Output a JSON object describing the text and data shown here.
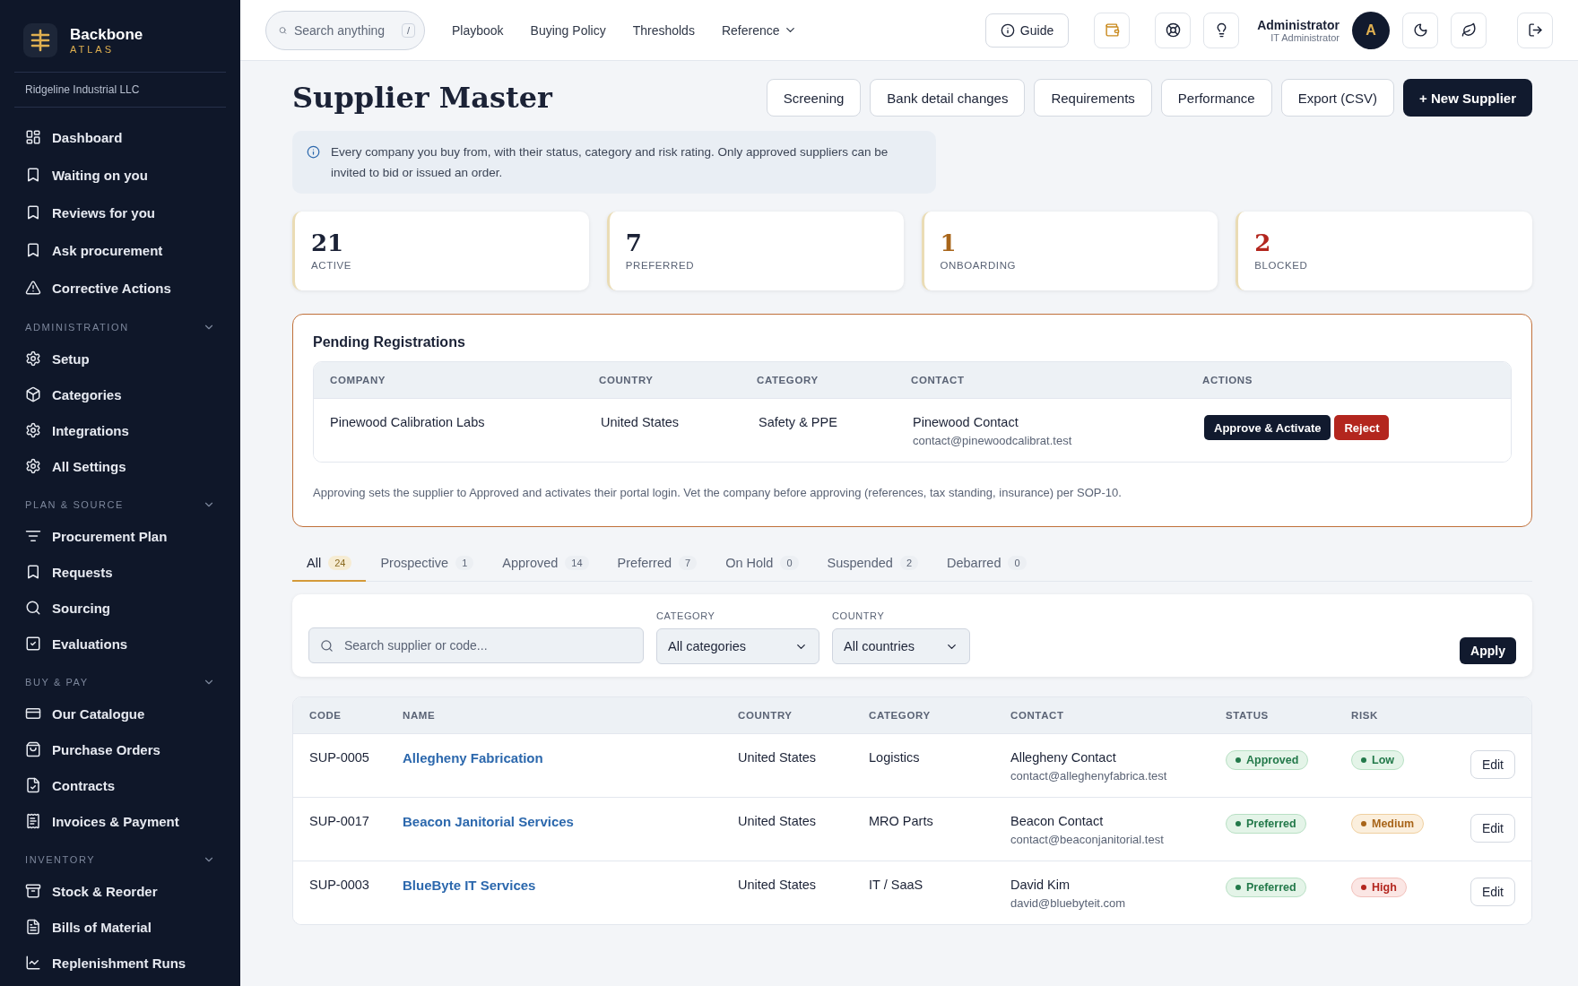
{
  "sidebar": {
    "brand": {
      "name": "Backbone",
      "sub": "ATLAS"
    },
    "org": "Ridgeline Industrial LLC",
    "items": [
      {
        "label": "Dashboard"
      },
      {
        "label": "Waiting on you"
      },
      {
        "label": "Reviews for you"
      },
      {
        "label": "Ask procurement"
      },
      {
        "label": "Corrective Actions"
      }
    ],
    "groups": [
      {
        "title": "ADMINISTRATION",
        "expanded": true,
        "items": [
          {
            "label": "Setup"
          },
          {
            "label": "Categories"
          },
          {
            "label": "Integrations"
          },
          {
            "label": "All Settings"
          }
        ]
      },
      {
        "title": "PLAN & SOURCE",
        "expanded": true,
        "items": [
          {
            "label": "Procurement Plan"
          },
          {
            "label": "Requests"
          },
          {
            "label": "Sourcing"
          },
          {
            "label": "Evaluations"
          }
        ]
      },
      {
        "title": "BUY & PAY",
        "expanded": true,
        "items": [
          {
            "label": "Our Catalogue"
          },
          {
            "label": "Purchase Orders"
          },
          {
            "label": "Contracts"
          },
          {
            "label": "Invoices & Payment"
          }
        ]
      },
      {
        "title": "INVENTORY",
        "expanded": true,
        "items": [
          {
            "label": "Stock & Reorder"
          },
          {
            "label": "Bills of Material"
          },
          {
            "label": "Replenishment Runs"
          }
        ]
      }
    ]
  },
  "topbar": {
    "search": {
      "placeholder": "Search anything",
      "shortcut": "/"
    },
    "links": [
      "Playbook",
      "Buying Policy",
      "Thresholds"
    ],
    "menu": "Reference",
    "guide": "Guide",
    "user": {
      "name": "Administrator",
      "role": "IT Administrator",
      "initial": "A"
    }
  },
  "page": {
    "title": "Supplier Master",
    "actions": [
      "Screening",
      "Bank detail changes",
      "Requirements",
      "Performance",
      "Export (CSV)"
    ],
    "primary_action": "+ New Supplier",
    "info": "Every company you buy from, with their status, category and risk rating. Only approved suppliers can be invited to bid or issued an order."
  },
  "stats": [
    {
      "value": "21",
      "label": "ACTIVE",
      "color": "#1b2236"
    },
    {
      "value": "7",
      "label": "PREFERRED",
      "color": "#1b2236"
    },
    {
      "value": "1",
      "label": "ONBOARDING",
      "color": "#a8651a"
    },
    {
      "value": "2",
      "label": "BLOCKED",
      "color": "#b3261e"
    }
  ],
  "pending": {
    "title": "Pending Registrations",
    "columns": [
      "COMPANY",
      "COUNTRY",
      "CATEGORY",
      "CONTACT",
      "ACTIONS"
    ],
    "rows": [
      {
        "company": "Pinewood Calibration Labs",
        "country": "United States",
        "category": "Safety & PPE",
        "contact": "Pinewood Contact",
        "email": "contact@pinewoodcalibrat.test",
        "approve": "Approve & Activate",
        "reject": "Reject"
      }
    ],
    "note": "Approving sets the supplier to Approved and activates their portal login. Vet the company before approving (references, tax standing, insurance) per SOP-10."
  },
  "tabs": [
    {
      "label": "All",
      "count": "24",
      "selected": true
    },
    {
      "label": "Prospective",
      "count": "1",
      "selected": false
    },
    {
      "label": "Approved",
      "count": "14",
      "selected": false
    },
    {
      "label": "Preferred",
      "count": "7",
      "selected": false
    },
    {
      "label": "On Hold",
      "count": "0",
      "selected": false
    },
    {
      "label": "Suspended",
      "count": "2",
      "selected": false
    },
    {
      "label": "Debarred",
      "count": "0",
      "selected": false
    }
  ],
  "filters": {
    "search": {
      "placeholder": "Search supplier or code..."
    },
    "category": {
      "label": "CATEGORY",
      "value": "All categories"
    },
    "country": {
      "label": "COUNTRY",
      "value": "All countries"
    },
    "apply": "Apply"
  },
  "table": {
    "columns": [
      "CODE",
      "NAME",
      "COUNTRY",
      "CATEGORY",
      "CONTACT",
      "STATUS",
      "RISK"
    ],
    "rows": [
      {
        "code": "SUP-0005",
        "name": "Allegheny Fabrication",
        "country": "United States",
        "category": "Logistics",
        "contact": "Allegheny Contact",
        "email": "contact@alleghenyfabrica.test",
        "status": {
          "label": "Approved",
          "kind": "good"
        },
        "risk": {
          "label": "Low",
          "kind": "good"
        },
        "edit": "Edit"
      },
      {
        "code": "SUP-0017",
        "name": "Beacon Janitorial Services",
        "country": "United States",
        "category": "MRO Parts",
        "contact": "Beacon Contact",
        "email": "contact@beaconjanitorial.test",
        "status": {
          "label": "Preferred",
          "kind": "good"
        },
        "risk": {
          "label": "Medium",
          "kind": "warn"
        },
        "edit": "Edit"
      },
      {
        "code": "SUP-0003",
        "name": "BlueByte IT Services",
        "country": "United States",
        "category": "IT / SaaS",
        "contact": "David Kim",
        "email": "david@bluebyteit.com",
        "status": {
          "label": "Preferred",
          "kind": "good"
        },
        "risk": {
          "label": "High",
          "kind": "bad"
        },
        "edit": "Edit"
      }
    ]
  }
}
